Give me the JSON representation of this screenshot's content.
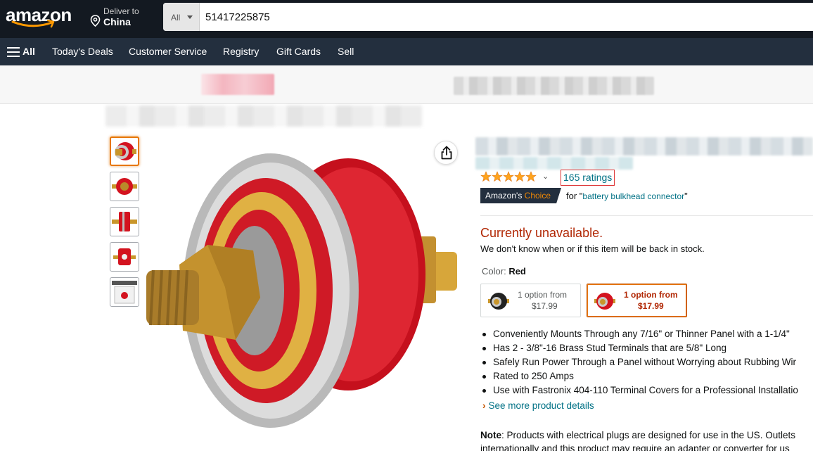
{
  "header": {
    "logo_text": "amazon",
    "deliver_label": "Deliver to",
    "deliver_location": "China",
    "search_category": "All",
    "search_value": "51417225875"
  },
  "nav": {
    "all_label": "All",
    "items": [
      "Today's Deals",
      "Customer Service",
      "Registry",
      "Gift Cards",
      "Sell"
    ]
  },
  "product": {
    "rating_stars": 4.5,
    "ratings_count": "165 ratings",
    "choice_badge_left": "Amazon's",
    "choice_badge_right": "Choice",
    "choice_for_prefix": "for \"",
    "choice_keyword": "battery bulkhead connector",
    "choice_for_suffix": "\"",
    "availability": "Currently unavailable.",
    "availability_sub": "We don't know when or if this item will be back in stock.",
    "color_label": "Color:",
    "color_value": "Red",
    "swatches": [
      {
        "line1": "1 option from",
        "line2": "$17.99"
      },
      {
        "line1": "1 option from",
        "line2": "$17.99"
      }
    ],
    "bullets": [
      "Conveniently Mounts Through any 7/16\" or Thinner Panel with a 1-1/4\"",
      "Has 2 - 3/8\"-16 Brass Stud Terminals that are 5/8\" Long",
      "Safely Run Power Through a Panel without Worrying about Rubbing Wir",
      "Rated to 250 Amps",
      "Use with Fastronix 404-110 Terminal Covers for a Professional Installatio"
    ],
    "see_more": "See more product details",
    "note_label": "Note",
    "note_line1": ": Products with electrical plugs are designed for use in the US. Outlets",
    "note_line2": "internationally and this product may require an adapter or converter for us"
  },
  "colors": {
    "header_bg": "#131921",
    "nav_bg": "#232f3e",
    "link": "#007185",
    "unavailable": "#b12704",
    "star": "#ffa41c",
    "selected_border": "#e77600"
  },
  "icons": [
    "location-pin-icon",
    "caret-down-icon",
    "hamburger-menu-icon",
    "share-icon",
    "star-icon",
    "chevron-right-icon"
  ]
}
